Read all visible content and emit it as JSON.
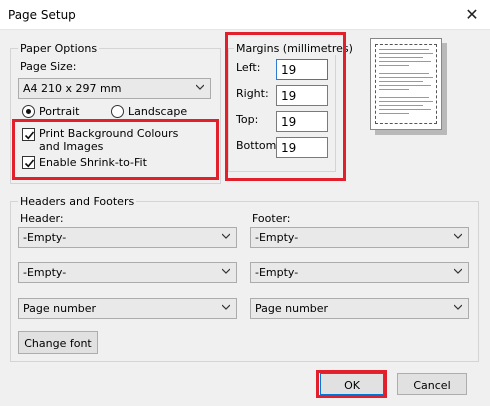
{
  "window": {
    "title": "Page Setup",
    "close_glyph": "✕"
  },
  "paper_options": {
    "group_label": "Paper Options",
    "page_size_label": "Page Size:",
    "page_size_value": "A4 210 x 297 mm",
    "orientation": {
      "portrait_label": "Portrait",
      "landscape_label": "Landscape",
      "selected": "Portrait"
    },
    "print_background_label": "Print Background Colours and Images",
    "print_background_checked": true,
    "shrink_label": "Enable Shrink-to-Fit",
    "shrink_checked": true
  },
  "margins": {
    "group_label": "Margins (millimetres)",
    "left_label": "Left:",
    "left_value": "19",
    "right_label": "Right:",
    "right_value": "19",
    "top_label": "Top:",
    "top_value": "19",
    "bottom_label": "Bottom:",
    "bottom_value": "19"
  },
  "headers_footers": {
    "group_label": "Headers and Footers",
    "header_label": "Header:",
    "footer_label": "Footer:",
    "header_values": [
      "-Empty-",
      "-Empty-",
      "Page number"
    ],
    "footer_values": [
      "-Empty-",
      "-Empty-",
      "Page number"
    ],
    "change_font_label": "Change font"
  },
  "buttons": {
    "ok_label": "OK",
    "cancel_label": "Cancel"
  },
  "colors": {
    "highlight": "#e2202c",
    "focus": "#2e7bd1",
    "background": "#f0f0f0"
  }
}
